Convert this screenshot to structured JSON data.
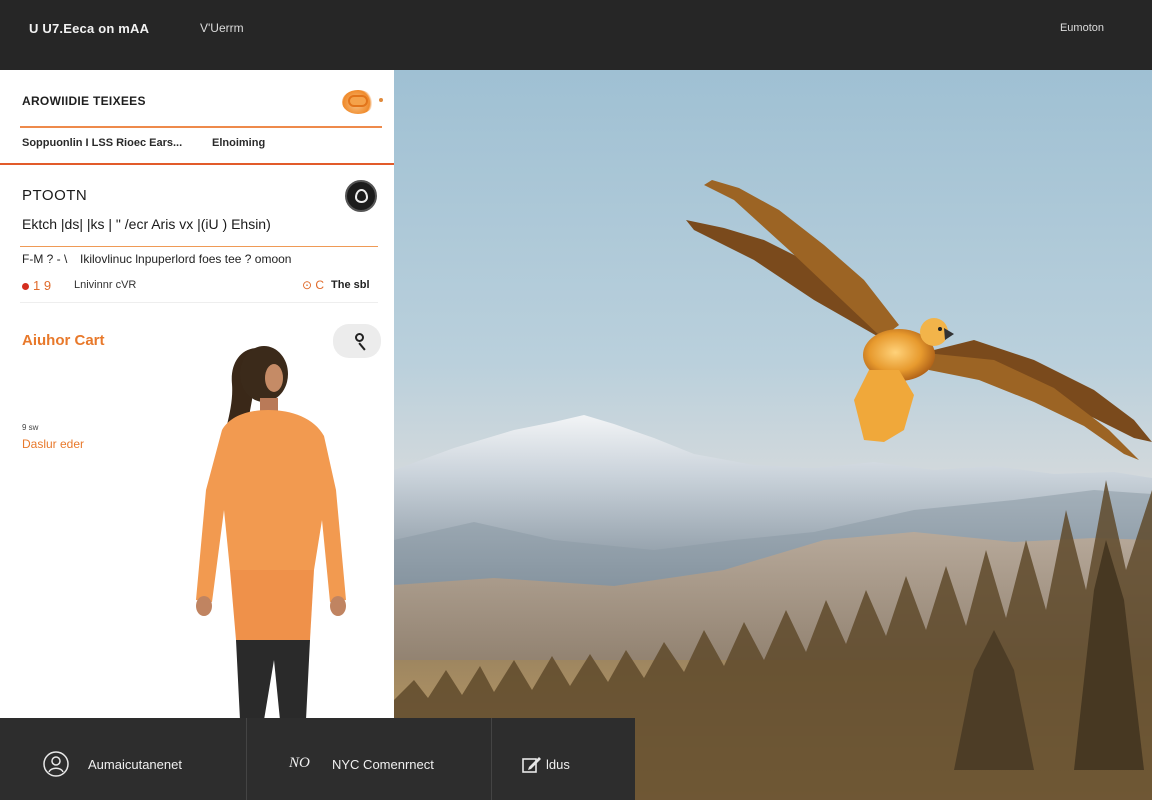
{
  "header": {
    "brand": "U U7.Eeca  on  mAA",
    "nav_link": "V'Uerrm",
    "right_link": "Eumoton"
  },
  "panel": {
    "title": "AROWIIDIE TEIXEES",
    "subtitle_left": "Soppuonlin I LSS Rioec Ears...",
    "subtitle_right": "Elnoiming",
    "section_heading": "PTOOTN",
    "section_line": "Ektch |ds| |ks |  \"  /ecr   Aris   vx   |(iU  ) Ehsin)",
    "row2_code": "F-M  ?  ‑  \\",
    "row2_text": "Ikilovlinuc  lnpuperlord  foes  tee  ?  omoon",
    "row3_num": "1 9",
    "row3_label": "Lnivinnr  cVR",
    "row3_right_icon": "⊙ C",
    "row3_right": "The sbl",
    "action_title": "Aiuhor Cart",
    "small_label": "9 sw",
    "link": "Daslur eder"
  },
  "footer": {
    "tab_1": "Aumaicutanenet",
    "tab_2": "NYC Comenrnect",
    "tab_2_icon_text": "NO",
    "tab_3": "ldus"
  },
  "icons": {
    "badge": "orange-ribbon-icon",
    "circle": "pin-icon",
    "search": "search-icon",
    "tab_1_icon": "person-circle-icon",
    "tab_3_icon": "edit-icon"
  },
  "colors": {
    "accent": "#e8792b",
    "rule": "#e25b2a",
    "topbar": "#262626",
    "bottombar": "#2d2d2d"
  }
}
